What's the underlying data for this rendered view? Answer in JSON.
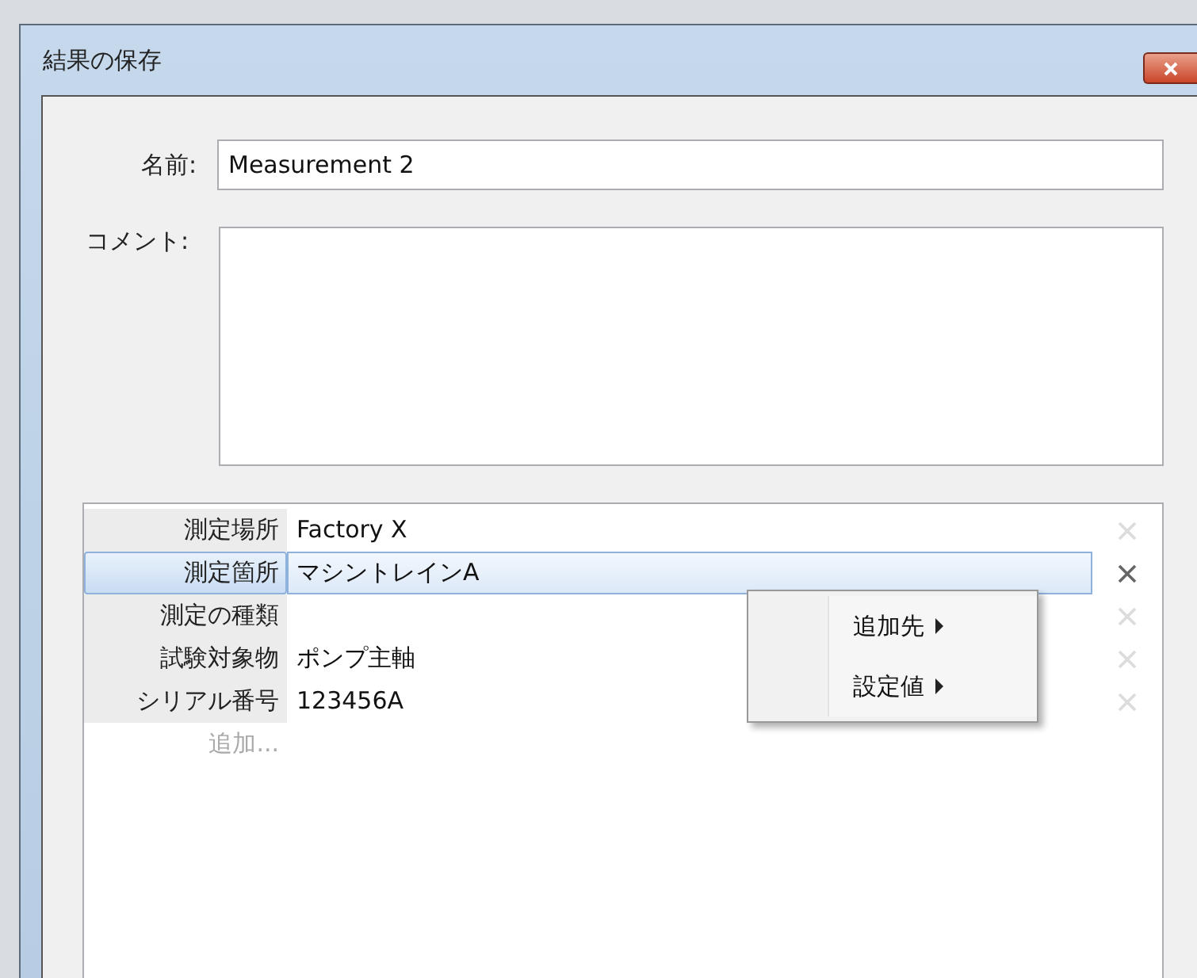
{
  "window": {
    "title": "結果の保存"
  },
  "name_field": {
    "label": "名前:",
    "value": "Measurement 2"
  },
  "comment_field": {
    "label": "コメント:"
  },
  "properties": [
    {
      "label": "測定場所",
      "value": "Factory X",
      "selected": false
    },
    {
      "label": "測定箇所",
      "value": "マシントレインA",
      "selected": true
    },
    {
      "label": "測定の種類",
      "selected": false
    },
    {
      "label": "試験対象物",
      "value": "ポンプ主軸",
      "selected": false
    },
    {
      "label": "シリアル番号",
      "value": "123456A",
      "selected": false
    }
  ],
  "add_item": "追加...",
  "context_menu": {
    "items": [
      {
        "label": "追加先"
      },
      {
        "label": "設定値"
      }
    ]
  }
}
